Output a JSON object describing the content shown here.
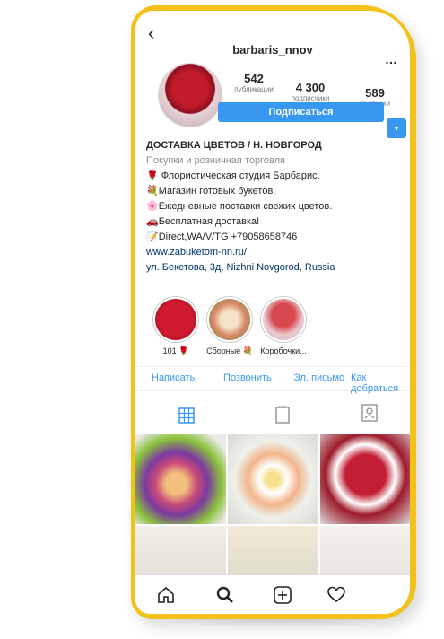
{
  "header": {
    "back_icon": "‹",
    "username": "barbaris_nnov",
    "more_icon": "…"
  },
  "stats": {
    "posts": {
      "value": "542",
      "label": "публикации"
    },
    "followers": {
      "value": "4 300",
      "label": "подписчики"
    },
    "following": {
      "value": "589",
      "label": "подписки"
    }
  },
  "follow_button": "Подписаться",
  "dropdown_icon": "▾",
  "bio": {
    "name": "ДОСТАВКА ЦВЕТОВ / Н. НОВГОРОД",
    "category": "Покупки и розничная торговля",
    "lines": [
      "🌹 Флористическая студия Барбарис.",
      "💐Магазин готовых букетов.",
      "🌸Ежедневные поставки свежих цветов.",
      "🚗Бесплатная доставка!",
      "📝Direct,WA/V/TG +79058658746"
    ],
    "link": "www.zabuketom-nn.ru/",
    "address": "ул. Бекетова, 3д, Nizhni Novgorod, Russia"
  },
  "highlights": [
    {
      "label": "101 🌹"
    },
    {
      "label": "Сборные 💐"
    },
    {
      "label": "Коробочки..."
    }
  ],
  "actions": [
    "Написать",
    "Позвонить",
    "Эл. письмо",
    "Как добраться"
  ],
  "tabs": [
    "grid-icon",
    "igtv-icon",
    "tagged-icon"
  ],
  "nav": {
    "home_icon": "⌂",
    "search_icon": "⌕",
    "add_icon": "⊞",
    "heart_icon": "♡"
  },
  "colors": {
    "phone_frame": "#f3c21a",
    "accent": "#3897f0",
    "link": "#003569"
  }
}
